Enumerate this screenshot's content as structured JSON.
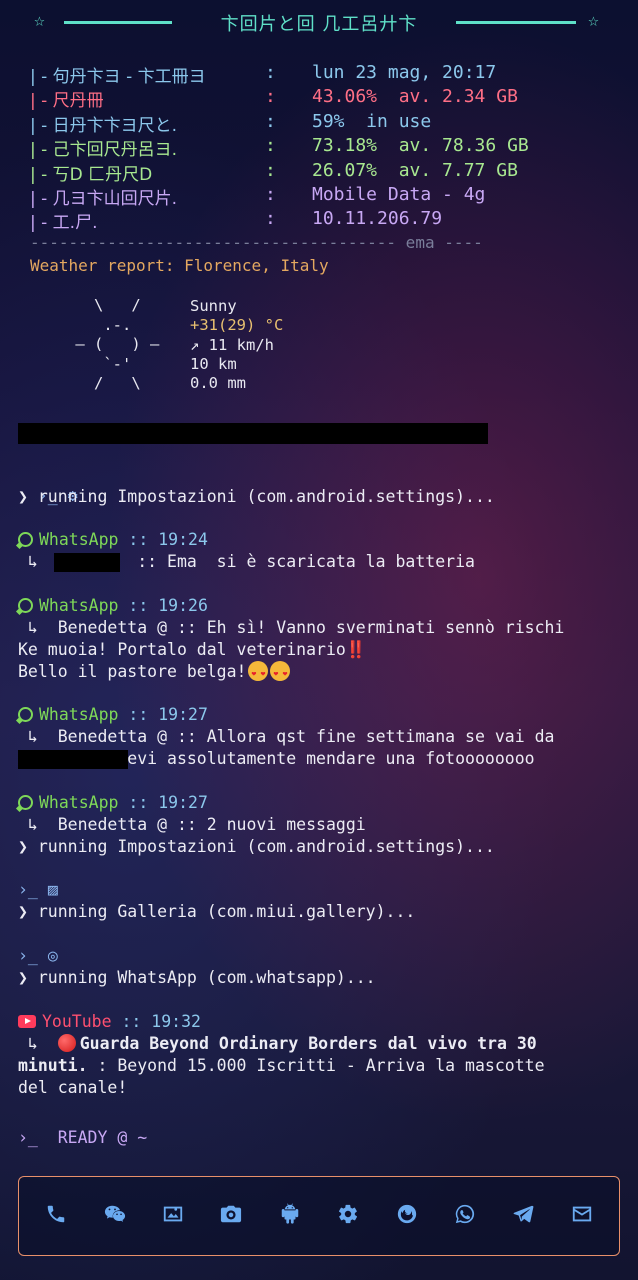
{
  "header": {
    "title": "卞回片と回 几工呂廾卞",
    "star_left": "☆",
    "star_right": "☆"
  },
  "sysinfo": [
    {
      "key": "| - 句丹卞ヨ - 卞工冊ヨ",
      "colon": ":",
      "value": "lun 23 mag, 20:17",
      "color": "#8cc8ec"
    },
    {
      "key": "| - 尺丹冊",
      "colon": ":",
      "value": "43.06%  av. 2.34 GB",
      "color": "#ff6f86"
    },
    {
      "key": "| - 日丹卞卞ヨ尺と.",
      "colon": ":",
      "value": "59%  in use",
      "color": "#8cc8ec"
    },
    {
      "key": "| - 己卞回尺丹呂ヨ.",
      "colon": ":",
      "value": "73.18%  av. 78.36 GB",
      "color": "#a8e890"
    },
    {
      "key": "| - 丂D 匚丹尺D",
      "colon": ":",
      "value": "26.07%  av. 7.77 GB",
      "color": "#a8e890"
    },
    {
      "key": "| - 几ヨ卞山回尺片.",
      "colon": ":",
      "value": "Mobile Data - 4g",
      "color": "#c8a8f4"
    },
    {
      "key": "| - 工.尸.",
      "colon": ":",
      "value": "10.11.206.79",
      "color": "#c8a8f4"
    }
  ],
  "divider": "-------------------------------------- ema ----",
  "weather": {
    "title": "Weather report: Florence, Italy",
    "ascii": "   \\   /\n    .-.\n ― (   ) ―\n    `-'\n   /   \\",
    "condition": "Sunny",
    "temp": "+31(29) °C",
    "wind": "↗ 11 km/h",
    "visibility": "10 km",
    "precip": "0.0 mm"
  },
  "logs": {
    "l1_prompt": "›_",
    "l1_run": "❯ running Impostazioni (com.android.settings)...",
    "n1_app": "WhatsApp",
    "n1_sep": " :: ",
    "n1_time": "19:24",
    "n1_body": " ↳          :: Ema  si è scaricata la batteria",
    "n2_app": "WhatsApp",
    "n2_time": "19:26",
    "n2_sender": " ↳  Benedetta @",
    "n2_msg": " :: Eh sì! Vanno sverminati sennò rischi",
    "n2_line2": "Ke muoia! Portalo dal veterinario‼️",
    "n2_line3": "Bello il pastore belga!",
    "n3_app": "WhatsApp",
    "n3_time": "19:27",
    "n3_sender": " ↳  Benedetta @",
    "n3_msg": " :: Allora qst fine settimana se vai da",
    "n3_line2": "           evi assolutamente mendare una fotoooooooo",
    "n4_app": "WhatsApp",
    "n4_time": "19:27",
    "n4_sender": " ↳  Benedetta @",
    "n4_msg": " :: 2 nuovi messaggi",
    "l2_run": "❯ running Impostazioni (com.android.settings)...",
    "l3_prompt": "›_",
    "l3_run": "❯ running Galleria (com.miui.gallery)...",
    "l4_prompt": "›_",
    "l4_run": "❯ running WhatsApp (com.whatsapp)...",
    "yt_app": "YouTube",
    "yt_time": "19:32",
    "yt_body1": "Guarda Beyond Ordinary Borders dal vivo tra 30",
    "yt_body2_a": "minuti.",
    "yt_body2_b": " : Beyond 15.000 Iscritti - Arriva la mascotte",
    "yt_body3": "del canale!",
    "ready": "›_  READY @ ~"
  },
  "dock": [
    "phone-icon",
    "wechat-icon",
    "gallery-icon",
    "camera-icon",
    "android-icon",
    "settings-icon",
    "firefox-icon",
    "whatsapp-icon",
    "telegram-icon",
    "mail-icon"
  ],
  "colors": {
    "accent": "#5fe0c8",
    "dock_border": "#e8906a",
    "dock_icon": "#6aaaf0"
  }
}
